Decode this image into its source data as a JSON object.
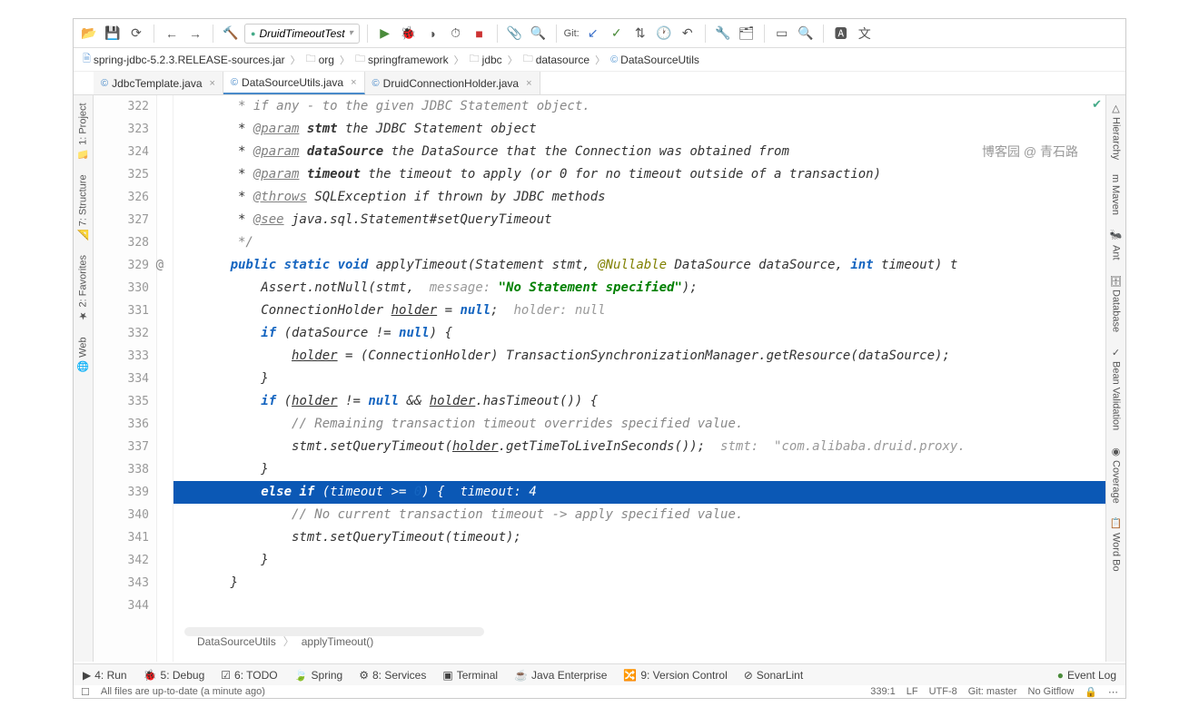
{
  "toolbar": {
    "run_config": "DruidTimeoutTest"
  },
  "breadcrumb": [
    {
      "icon": "jar",
      "label": "spring-jdbc-5.2.3.RELEASE-sources.jar"
    },
    {
      "icon": "folder",
      "label": "org"
    },
    {
      "icon": "folder",
      "label": "springframework"
    },
    {
      "icon": "folder",
      "label": "jdbc"
    },
    {
      "icon": "folder",
      "label": "datasource"
    },
    {
      "icon": "class",
      "label": "DataSourceUtils"
    }
  ],
  "tabs": [
    {
      "label": "JdbcTemplate.java",
      "active": false
    },
    {
      "label": "DataSourceUtils.java",
      "active": true
    },
    {
      "label": "DruidConnectionHolder.java",
      "active": false
    }
  ],
  "left_rail": [
    {
      "icon": "📁",
      "label": "1: Project"
    },
    {
      "icon": "📐",
      "label": "7: Structure"
    },
    {
      "icon": "★",
      "label": "2: Favorites"
    },
    {
      "icon": "🌐",
      "label": "Web"
    }
  ],
  "right_rail": [
    {
      "icon": "△",
      "label": "Hierarchy"
    },
    {
      "icon": "m",
      "label": "Maven"
    },
    {
      "icon": "🐜",
      "label": "Ant"
    },
    {
      "icon": "🗄",
      "label": "Database"
    },
    {
      "icon": "✓",
      "label": "Bean Validation"
    },
    {
      "icon": "◉",
      "label": "Coverage"
    },
    {
      "icon": "📋",
      "label": "Word Bo"
    }
  ],
  "watermark": "博客园 @ 青石路",
  "gutter_start": 322,
  "gutter_count": 23,
  "gutter_annot_line": 329,
  "gutter_annot": "@",
  "code_lines": [
    {
      "raw": "       * if any - to the given JDBC Statement object.",
      "cls": "comment"
    },
    {
      "html": "       * <span class='anno'>@param</span> <span class='param'>stmt</span> the JDBC Statement object"
    },
    {
      "html": "       * <span class='anno'>@param</span> <span class='param'>dataSource</span> the DataSource that the Connection was obtained from"
    },
    {
      "html": "       * <span class='anno'>@param</span> <span class='param'>timeout</span> the timeout to apply (or 0 for no timeout outside of a transaction)"
    },
    {
      "html": "       * <span class='anno'>@throws</span> SQLException if thrown by JDBC methods"
    },
    {
      "html": "       * <span class='anno'>@see</span> java.sql.Statement#setQueryTimeout"
    },
    {
      "raw": "       */",
      "cls": "comment"
    },
    {
      "html": "      <span class='kw'>public static void</span> applyTimeout(Statement stmt, <span class='annotation'>@Nullable</span> DataSource dataSource, <span class='kw'>int</span> timeout) t"
    },
    {
      "html": "          Assert.<span class='method'>notNull</span>(stmt,  <span class='hint'>message:</span> <span class='str'>\"No Statement specified\"</span>);"
    },
    {
      "html": "          ConnectionHolder <u>holder</u> = <span class='kw'>null</span>;  <span class='hint'>holder: null</span>"
    },
    {
      "html": "          <span class='kw'>if</span> (dataSource != <span class='kw'>null</span>) {"
    },
    {
      "html": "              <u>holder</u> = (ConnectionHolder) TransactionSynchronizationManager.<span class='method'>getResource</span>(dataSource);"
    },
    {
      "html": "          }"
    },
    {
      "html": "          <span class='kw'>if</span> (<u>holder</u> != <span class='kw'>null</span> && <u>holder</u>.hasTimeout()) {"
    },
    {
      "html": "              <span class='comment'>// Remaining transaction timeout overrides specified value.</span>"
    },
    {
      "html": "              stmt.setQueryTimeout(<u>holder</u>.getTimeToLiveInSeconds());  <span class='hint'>stmt:  \"com.alibaba.druid.proxy.</span>"
    },
    {
      "html": "          }"
    },
    {
      "html": "          <span class='kw'>else if</span> (timeout >= <span class='num'>0</span>) {  <span class='hint'>timeout: 4</span>",
      "highlighted": true
    },
    {
      "html": "              <span class='comment'>// No current transaction timeout -> apply specified value.</span>"
    },
    {
      "html": "              stmt.setQueryTimeout(timeout);"
    },
    {
      "html": "          }"
    },
    {
      "html": "      }"
    },
    {
      "html": ""
    }
  ],
  "breadcrumb_bottom": [
    "DataSourceUtils",
    "applyTimeout()"
  ],
  "bottom_bar": [
    {
      "icon": "▶",
      "label": "4: Run"
    },
    {
      "icon": "🐞",
      "label": "5: Debug"
    },
    {
      "icon": "☑",
      "label": "6: TODO"
    },
    {
      "icon": "🍃",
      "label": "Spring"
    },
    {
      "icon": "⚙",
      "label": "8: Services"
    },
    {
      "icon": "▣",
      "label": "Terminal"
    },
    {
      "icon": "☕",
      "label": "Java Enterprise"
    },
    {
      "icon": "🔀",
      "label": "9: Version Control"
    },
    {
      "icon": "⊘",
      "label": "SonarLint"
    }
  ],
  "event_log": "Event Log",
  "status": {
    "message": "All files are up-to-date (a minute ago)",
    "cursor": "339:1",
    "line_sep": "LF",
    "encoding": "UTF-8",
    "git": "Git: master",
    "gitflow": "No Gitflow"
  }
}
